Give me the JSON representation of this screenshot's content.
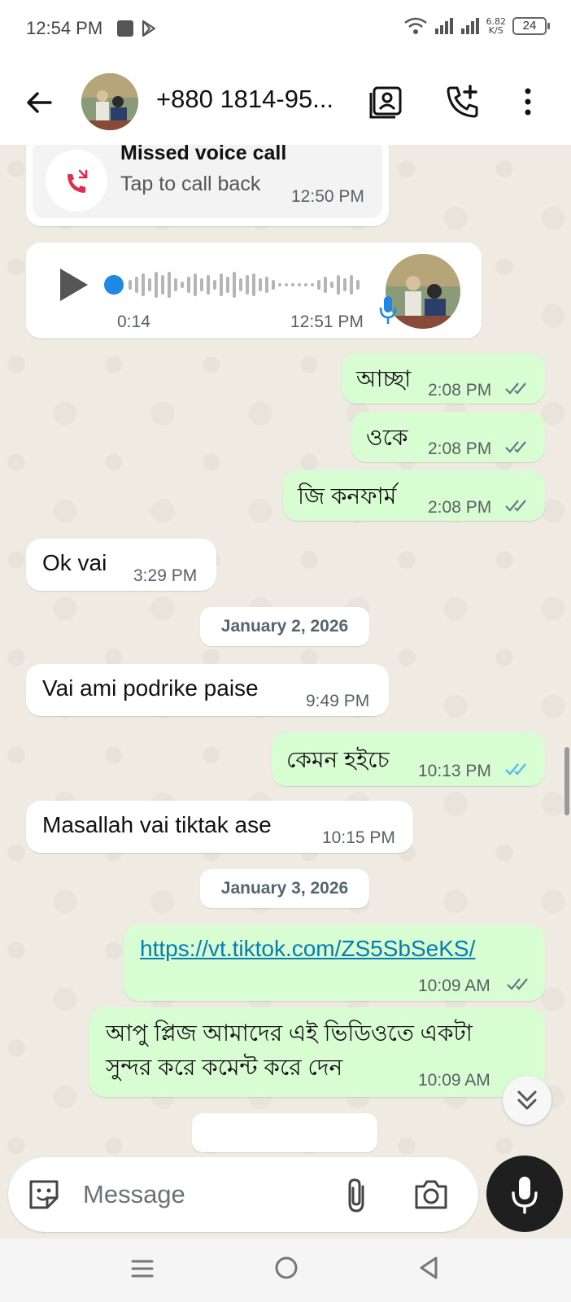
{
  "status_bar": {
    "time": "12:54 PM",
    "net_speed_value": "6.82",
    "net_speed_unit": "K/S",
    "battery": "24"
  },
  "header": {
    "contact_name": "+880 1814-95...",
    "icons": [
      "back-arrow-icon",
      "contact-card-icon",
      "add-call-icon",
      "more-vert-icon"
    ]
  },
  "chat": {
    "missed_call": {
      "title": "Missed voice call",
      "subtitle": "Tap to call back",
      "time": "12:50 PM"
    },
    "voice_note": {
      "duration": "0:14",
      "time": "12:51 PM"
    },
    "messages": [
      {
        "dir": "out",
        "text": "আচ্ছা",
        "time": "2:08 PM",
        "status": "delivered"
      },
      {
        "dir": "out",
        "text": "ওকে",
        "time": "2:08 PM",
        "status": "delivered"
      },
      {
        "dir": "out",
        "text": "জি কনফার্ম",
        "time": "2:08 PM",
        "status": "delivered"
      },
      {
        "dir": "in",
        "text": "Ok vai",
        "time": "3:29 PM"
      },
      {
        "dir": "in",
        "text": "Vai ami podrike paise",
        "time": "9:49 PM"
      },
      {
        "dir": "out",
        "text": "কেমন হইচে",
        "time": "10:13 PM",
        "status": "read"
      },
      {
        "dir": "in",
        "text": "Masallah vai tiktak ase",
        "time": "10:15 PM"
      },
      {
        "dir": "out",
        "text": "https://vt.tiktok.com/ZS5SbSeKS/",
        "time": "10:09 AM",
        "status": "delivered"
      },
      {
        "dir": "out",
        "text_line1": "আপু প্লিজ আমাদের এই ভিডিওতে একটা",
        "text_line2": "সুন্দর করে কমেন্ট করে দেন",
        "time": "10:09 AM"
      }
    ],
    "dates": [
      "January 2, 2026",
      "January 3, 2026"
    ]
  },
  "composer": {
    "placeholder": "Message"
  },
  "colors": {
    "outgoing_bubble": "#d9fdd3",
    "incoming_bubble": "#ffffff",
    "read_tick": "#53bdeb",
    "missed_call_red": "#e02d4f",
    "link": "#027eb5",
    "voice_dot": "#1e88e5"
  }
}
